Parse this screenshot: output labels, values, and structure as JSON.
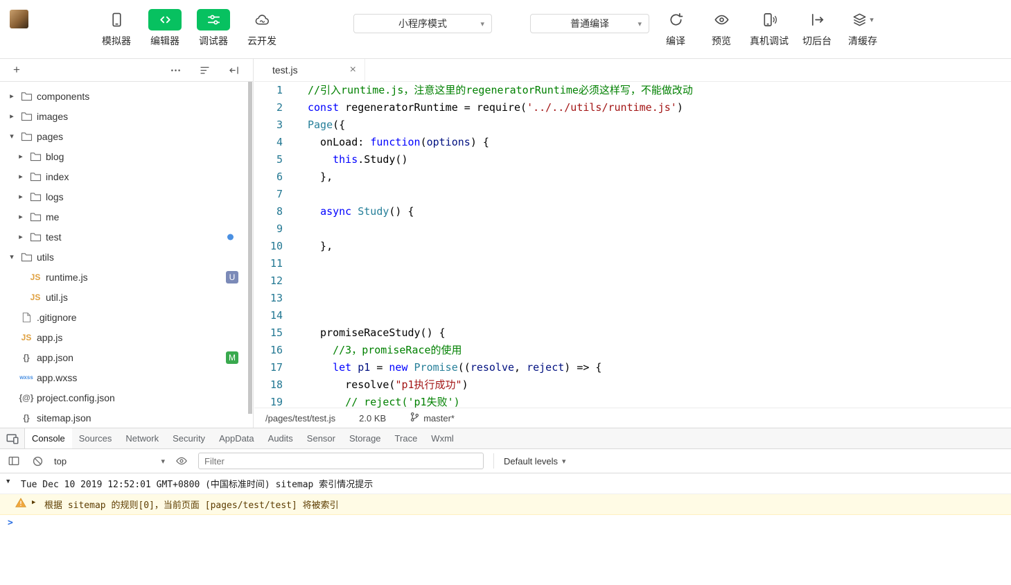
{
  "topbar": {
    "device_buttons": [
      {
        "id": "simulator",
        "label": "模拟器",
        "icon": "phone-icon",
        "green": false
      },
      {
        "id": "editor",
        "label": "编辑器",
        "icon": "code-icon",
        "green": true
      },
      {
        "id": "debugger",
        "label": "调试器",
        "icon": "sliders-icon",
        "green": true
      },
      {
        "id": "cloud-dev",
        "label": "云开发",
        "icon": "cloud-icon",
        "green": false
      }
    ],
    "mode_select": {
      "value": "小程序模式"
    },
    "compile_select": {
      "value": "普通编译"
    },
    "action_buttons": [
      {
        "id": "compile",
        "label": "编译",
        "icon": "refresh-icon"
      },
      {
        "id": "preview",
        "label": "预览",
        "icon": "eye-icon"
      },
      {
        "id": "remote-debug",
        "label": "真机调试",
        "icon": "phone-signal-icon"
      },
      {
        "id": "switch-background",
        "label": "切后台",
        "icon": "switch-icon"
      },
      {
        "id": "clear-cache",
        "label": "清缓存",
        "icon": "layers-icon",
        "caret": true
      }
    ],
    "accent_green": "#07c160"
  },
  "explorer": {
    "header_left_buttons": [
      {
        "id": "new-file",
        "icon": "plus-icon"
      },
      {
        "id": "search",
        "icon": "search-icon"
      }
    ],
    "header_right_buttons": [
      {
        "id": "more",
        "icon": "more-icon"
      },
      {
        "id": "open-editors",
        "icon": "list-icon"
      },
      {
        "id": "collapse-all",
        "icon": "collapse-all-icon"
      }
    ],
    "tree": [
      {
        "label": "components",
        "kind": "folder",
        "level": 0,
        "expanded": false
      },
      {
        "label": "images",
        "kind": "folder",
        "level": 0,
        "expanded": false
      },
      {
        "label": "pages",
        "kind": "folder",
        "level": 0,
        "expanded": true
      },
      {
        "label": "blog",
        "kind": "folder",
        "level": 1,
        "expanded": false
      },
      {
        "label": "index",
        "kind": "folder",
        "level": 1,
        "expanded": false
      },
      {
        "label": "logs",
        "kind": "folder",
        "level": 1,
        "expanded": false
      },
      {
        "label": "me",
        "kind": "folder",
        "level": 1,
        "expanded": false
      },
      {
        "label": "test",
        "kind": "folder",
        "level": 1,
        "expanded": false,
        "dot": true
      },
      {
        "label": "utils",
        "kind": "folder",
        "level": 0,
        "expanded": true
      },
      {
        "label": "runtime.js",
        "kind": "js",
        "level": 1,
        "badge": "U"
      },
      {
        "label": "util.js",
        "kind": "js",
        "level": 1
      },
      {
        "label": ".gitignore",
        "kind": "file",
        "level": 0
      },
      {
        "label": "app.js",
        "kind": "js",
        "level": 0
      },
      {
        "label": "app.json",
        "kind": "json",
        "level": 0,
        "badge": "M"
      },
      {
        "label": "app.wxss",
        "kind": "wxss",
        "level": 0
      },
      {
        "label": "project.config.json",
        "kind": "config",
        "level": 0
      },
      {
        "label": "sitemap.json",
        "kind": "json",
        "level": 0
      }
    ]
  },
  "editor": {
    "tab": {
      "title": "test.js"
    },
    "status": {
      "path": "/pages/test/test.js",
      "size": "2.0 KB",
      "branch": "master*"
    },
    "code": [
      {
        "n": 1,
        "tokens": [
          [
            "comment",
            "//引入runtime.js，注意这里的regeneratorRuntime必须这样写，不能做改动"
          ]
        ]
      },
      {
        "n": 2,
        "tokens": [
          [
            "kw",
            "const"
          ],
          [
            "plain",
            " regeneratorRuntime = require("
          ],
          [
            "str",
            "'../../utils/runtime.js'"
          ],
          [
            "plain",
            ")"
          ]
        ]
      },
      {
        "n": 3,
        "tokens": [
          [
            "type",
            "Page"
          ],
          [
            "plain",
            "({"
          ]
        ]
      },
      {
        "n": 4,
        "tokens": [
          [
            "plain",
            "  onLoad: "
          ],
          [
            "kw",
            "function"
          ],
          [
            "plain",
            "("
          ],
          [
            "ident",
            "options"
          ],
          [
            "plain",
            ") {"
          ]
        ]
      },
      {
        "n": 5,
        "tokens": [
          [
            "plain",
            "    "
          ],
          [
            "kw",
            "this"
          ],
          [
            "plain",
            ".Study()"
          ]
        ]
      },
      {
        "n": 6,
        "tokens": [
          [
            "plain",
            "  },"
          ]
        ]
      },
      {
        "n": 7,
        "tokens": []
      },
      {
        "n": 8,
        "tokens": [
          [
            "plain",
            "  "
          ],
          [
            "kw",
            "async"
          ],
          [
            "plain",
            " "
          ],
          [
            "type",
            "Study"
          ],
          [
            "plain",
            "() {"
          ]
        ]
      },
      {
        "n": 9,
        "tokens": []
      },
      {
        "n": 10,
        "tokens": [
          [
            "plain",
            "  },"
          ]
        ]
      },
      {
        "n": 11,
        "tokens": []
      },
      {
        "n": 12,
        "tokens": []
      },
      {
        "n": 13,
        "tokens": []
      },
      {
        "n": 14,
        "tokens": []
      },
      {
        "n": 15,
        "tokens": [
          [
            "plain",
            "  promiseRaceStudy() {"
          ]
        ]
      },
      {
        "n": 16,
        "tokens": [
          [
            "plain",
            "    "
          ],
          [
            "comment",
            "//3，promiseRace的使用"
          ]
        ]
      },
      {
        "n": 17,
        "tokens": [
          [
            "plain",
            "    "
          ],
          [
            "kw",
            "let"
          ],
          [
            "plain",
            " "
          ],
          [
            "ident",
            "p1"
          ],
          [
            "plain",
            " = "
          ],
          [
            "kw",
            "new"
          ],
          [
            "plain",
            " "
          ],
          [
            "type",
            "Promise"
          ],
          [
            "plain",
            "(("
          ],
          [
            "ident",
            "resolve"
          ],
          [
            "plain",
            ", "
          ],
          [
            "ident",
            "reject"
          ],
          [
            "plain",
            ") => {"
          ]
        ]
      },
      {
        "n": 18,
        "tokens": [
          [
            "plain",
            "      resolve("
          ],
          [
            "str",
            "\"p1执行成功\""
          ],
          [
            "plain",
            ")"
          ]
        ]
      },
      {
        "n": 19,
        "tokens": [
          [
            "plain",
            "      "
          ],
          [
            "comment",
            "// reject('p1失败')"
          ]
        ]
      }
    ]
  },
  "devtools": {
    "tabs": [
      {
        "label": "Console",
        "active": true
      },
      {
        "label": "Sources",
        "active": false
      },
      {
        "label": "Network",
        "active": false
      },
      {
        "label": "Security",
        "active": false
      },
      {
        "label": "AppData",
        "active": false
      },
      {
        "label": "Audits",
        "active": false
      },
      {
        "label": "Sensor",
        "active": false
      },
      {
        "label": "Storage",
        "active": false
      },
      {
        "label": "Trace",
        "active": false
      },
      {
        "label": "Wxml",
        "active": false
      }
    ],
    "toolbar": {
      "frame": "top",
      "filter_placeholder": "Filter",
      "levels": "Default levels"
    },
    "messages": [
      {
        "type": "group",
        "text": "Tue Dec 10 2019 12:52:01 GMT+0800 (中国标准时间) sitemap 索引情况提示"
      },
      {
        "type": "warning",
        "text": "根据 sitemap 的规则[0]，当前页面 [pages/test/test] 将被索引"
      },
      {
        "type": "prompt"
      }
    ]
  },
  "glyphs": {
    "plus": "+",
    "close": "×",
    "caret-down": "▾",
    "more": "⋯",
    "expand-open": "▼",
    "expand-closed": "▶",
    "folder-arrow-open": "▾",
    "folder-arrow-closed": "▸",
    "prompt": ">"
  }
}
